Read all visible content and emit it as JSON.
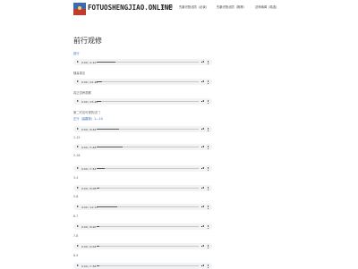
{
  "site": {
    "title": "FOTUOSHENGJIAO.ONLINE",
    "subtitle": "· · · · · ·"
  },
  "nav": [
    "前行视修",
    "先秦光阳北防（必读）",
    "先秦光阳北防（推荐）",
    "法师纳闻（精选）"
  ],
  "page_title": "前行观修",
  "sections": [
    {
      "label": "前行",
      "label_color": "blue",
      "time": "0:00 / 4:10",
      "progress": 0.18
    },
    {
      "label": "随喜观法",
      "label_color": "gray",
      "time": "0:00 / 21:46",
      "progress": 0.05
    },
    {
      "label": "真正供养观察",
      "label_color": "gray",
      "time": "0:00 / 15:20",
      "progress": 0.04
    },
    {
      "label": "第二时法可视的法门",
      "label_color": "gray",
      "time": "",
      "progress": 0
    },
    {
      "label": "正行（善趣篇）1—10",
      "label_color": "blue",
      "time": "0:00 / 8:46",
      "progress": 0.22
    },
    {
      "label": "1-15",
      "label_color": "gray",
      "time": "0:00 / 5:48",
      "progress": 0.25
    },
    {
      "label": "2-16",
      "label_color": "gray",
      "time": "0:00 / 7:44",
      "progress": 0.08
    },
    {
      "label": "3-4",
      "label_color": "gray",
      "time": "0:00 / 8:08",
      "progress": 0.03
    },
    {
      "label": "5-6",
      "label_color": "gray",
      "time": "0:00 / 12:13",
      "progress": 0.2
    },
    {
      "label": "6-7",
      "label_color": "gray",
      "time": "0:00 / 8:20",
      "progress": 0.03
    },
    {
      "label": "7-8",
      "label_color": "gray",
      "time": "0:00 / 6:04",
      "progress": 0.03
    },
    {
      "label": "8-9",
      "label_color": "gray",
      "time": "0:00 / 7:56",
      "progress": 0.03
    }
  ]
}
